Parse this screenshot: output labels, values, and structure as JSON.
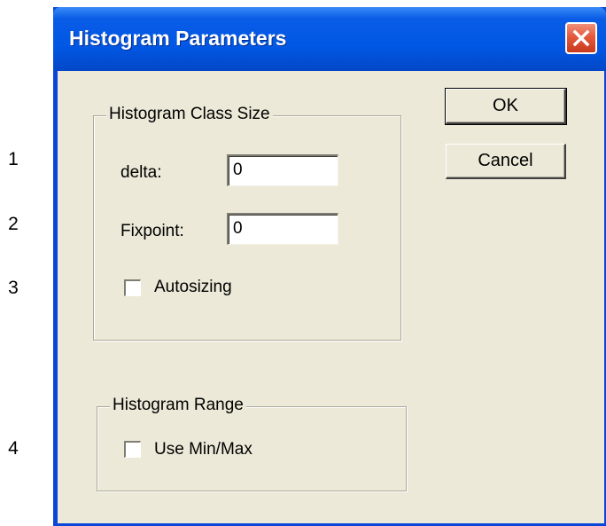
{
  "callouts": [
    "1",
    "2",
    "3",
    "4"
  ],
  "dialog": {
    "title": "Histogram Parameters",
    "close_icon": "close-icon"
  },
  "class_size_group": {
    "title": "Histogram Class Size",
    "delta": {
      "label": "delta:",
      "value": "0"
    },
    "fixpoint": {
      "label": "Fixpoint:",
      "value": "0"
    },
    "autosizing": {
      "label": "Autosizing",
      "checked": false
    }
  },
  "range_group": {
    "title": "Histogram Range",
    "use_min_max": {
      "label": "Use Min/Max",
      "checked": false
    }
  },
  "buttons": {
    "ok_label": "OK",
    "cancel_label": "Cancel"
  },
  "colors": {
    "titlebar": "#0058e4",
    "close_button": "#e35a3c",
    "client_background": "#ece9d8"
  }
}
